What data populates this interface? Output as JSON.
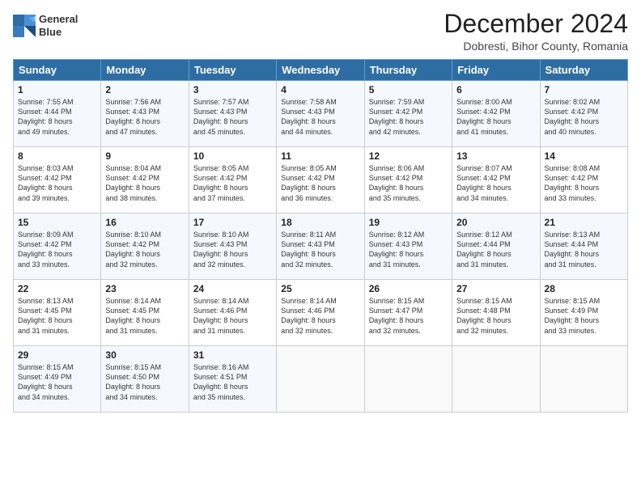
{
  "logo": {
    "line1": "General",
    "line2": "Blue"
  },
  "title": "December 2024",
  "subtitle": "Dobresti, Bihor County, Romania",
  "days_header": [
    "Sunday",
    "Monday",
    "Tuesday",
    "Wednesday",
    "Thursday",
    "Friday",
    "Saturday"
  ],
  "weeks": [
    [
      {
        "day": "1",
        "info": "Sunrise: 7:55 AM\nSunset: 4:44 PM\nDaylight: 8 hours\nand 49 minutes."
      },
      {
        "day": "2",
        "info": "Sunrise: 7:56 AM\nSunset: 4:43 PM\nDaylight: 8 hours\nand 47 minutes."
      },
      {
        "day": "3",
        "info": "Sunrise: 7:57 AM\nSunset: 4:43 PM\nDaylight: 8 hours\nand 45 minutes."
      },
      {
        "day": "4",
        "info": "Sunrise: 7:58 AM\nSunset: 4:43 PM\nDaylight: 8 hours\nand 44 minutes."
      },
      {
        "day": "5",
        "info": "Sunrise: 7:59 AM\nSunset: 4:42 PM\nDaylight: 8 hours\nand 42 minutes."
      },
      {
        "day": "6",
        "info": "Sunrise: 8:00 AM\nSunset: 4:42 PM\nDaylight: 8 hours\nand 41 minutes."
      },
      {
        "day": "7",
        "info": "Sunrise: 8:02 AM\nSunset: 4:42 PM\nDaylight: 8 hours\nand 40 minutes."
      }
    ],
    [
      {
        "day": "8",
        "info": "Sunrise: 8:03 AM\nSunset: 4:42 PM\nDaylight: 8 hours\nand 39 minutes."
      },
      {
        "day": "9",
        "info": "Sunrise: 8:04 AM\nSunset: 4:42 PM\nDaylight: 8 hours\nand 38 minutes."
      },
      {
        "day": "10",
        "info": "Sunrise: 8:05 AM\nSunset: 4:42 PM\nDaylight: 8 hours\nand 37 minutes."
      },
      {
        "day": "11",
        "info": "Sunrise: 8:05 AM\nSunset: 4:42 PM\nDaylight: 8 hours\nand 36 minutes."
      },
      {
        "day": "12",
        "info": "Sunrise: 8:06 AM\nSunset: 4:42 PM\nDaylight: 8 hours\nand 35 minutes."
      },
      {
        "day": "13",
        "info": "Sunrise: 8:07 AM\nSunset: 4:42 PM\nDaylight: 8 hours\nand 34 minutes."
      },
      {
        "day": "14",
        "info": "Sunrise: 8:08 AM\nSunset: 4:42 PM\nDaylight: 8 hours\nand 33 minutes."
      }
    ],
    [
      {
        "day": "15",
        "info": "Sunrise: 8:09 AM\nSunset: 4:42 PM\nDaylight: 8 hours\nand 33 minutes."
      },
      {
        "day": "16",
        "info": "Sunrise: 8:10 AM\nSunset: 4:42 PM\nDaylight: 8 hours\nand 32 minutes."
      },
      {
        "day": "17",
        "info": "Sunrise: 8:10 AM\nSunset: 4:43 PM\nDaylight: 8 hours\nand 32 minutes."
      },
      {
        "day": "18",
        "info": "Sunrise: 8:11 AM\nSunset: 4:43 PM\nDaylight: 8 hours\nand 32 minutes."
      },
      {
        "day": "19",
        "info": "Sunrise: 8:12 AM\nSunset: 4:43 PM\nDaylight: 8 hours\nand 31 minutes."
      },
      {
        "day": "20",
        "info": "Sunrise: 8:12 AM\nSunset: 4:44 PM\nDaylight: 8 hours\nand 31 minutes."
      },
      {
        "day": "21",
        "info": "Sunrise: 8:13 AM\nSunset: 4:44 PM\nDaylight: 8 hours\nand 31 minutes."
      }
    ],
    [
      {
        "day": "22",
        "info": "Sunrise: 8:13 AM\nSunset: 4:45 PM\nDaylight: 8 hours\nand 31 minutes."
      },
      {
        "day": "23",
        "info": "Sunrise: 8:14 AM\nSunset: 4:45 PM\nDaylight: 8 hours\nand 31 minutes."
      },
      {
        "day": "24",
        "info": "Sunrise: 8:14 AM\nSunset: 4:46 PM\nDaylight: 8 hours\nand 31 minutes."
      },
      {
        "day": "25",
        "info": "Sunrise: 8:14 AM\nSunset: 4:46 PM\nDaylight: 8 hours\nand 32 minutes."
      },
      {
        "day": "26",
        "info": "Sunrise: 8:15 AM\nSunset: 4:47 PM\nDaylight: 8 hours\nand 32 minutes."
      },
      {
        "day": "27",
        "info": "Sunrise: 8:15 AM\nSunset: 4:48 PM\nDaylight: 8 hours\nand 32 minutes."
      },
      {
        "day": "28",
        "info": "Sunrise: 8:15 AM\nSunset: 4:49 PM\nDaylight: 8 hours\nand 33 minutes."
      }
    ],
    [
      {
        "day": "29",
        "info": "Sunrise: 8:15 AM\nSunset: 4:49 PM\nDaylight: 8 hours\nand 34 minutes."
      },
      {
        "day": "30",
        "info": "Sunrise: 8:15 AM\nSunset: 4:50 PM\nDaylight: 8 hours\nand 34 minutes."
      },
      {
        "day": "31",
        "info": "Sunrise: 8:16 AM\nSunset: 4:51 PM\nDaylight: 8 hours\nand 35 minutes."
      },
      null,
      null,
      null,
      null
    ]
  ]
}
